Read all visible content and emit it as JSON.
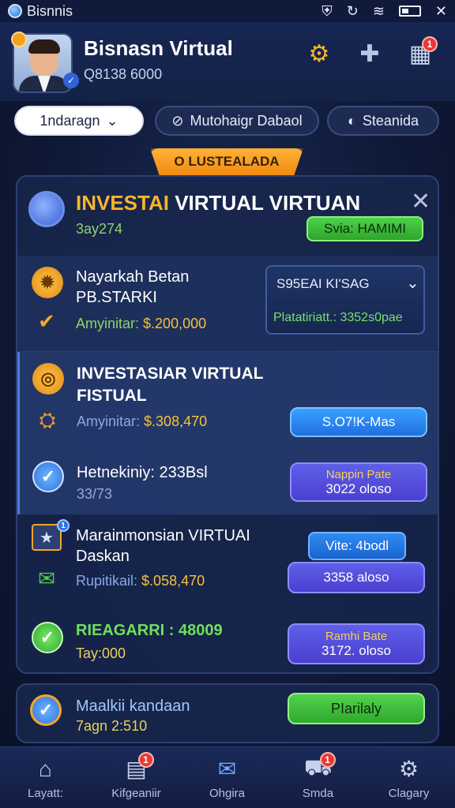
{
  "status_bar": {
    "app_name": "Bisnnis"
  },
  "header": {
    "name": "Bisnasn Virtual",
    "id": "Q8138 6000",
    "box_badge": "1"
  },
  "filters": {
    "dropdown_label": "1ndaragn",
    "pill2_label": "Mutohaigr Dabaol",
    "pill3_label": "Steanida"
  },
  "ribbon": {
    "label": "O LUSTEALADA"
  },
  "card": {
    "title_gold": "INVESTAI",
    "title_white": "VIRTUAL VIRTUAN",
    "subtitle": "3ay274",
    "badge": "Svia: HAMIMI",
    "row1": {
      "title_line1": "Nayarkah Betan",
      "title_line2": "PB.STARKI",
      "amount_label": "Amyinitar:",
      "amount_value": "$.200,000",
      "select_top": "S95EAI KI'SAG",
      "select_bottom": "Platatiriatt.: 3352s0pae"
    },
    "row2": {
      "title_line1": "INVESTASIAR VIRTUAL",
      "title_line2": "FISTUAL",
      "amount_label": "Amyinitar:",
      "amount_value": "$.308,470",
      "btn_label": "S.O7!K-Mas",
      "sub_title": "Hetnekiniy: 233Bsl",
      "sub_text": "33/73",
      "btn2_top": "Nappin Pate",
      "btn2_bottom": "3022 oloso"
    },
    "row3": {
      "title_line1": "Marainmonsian VIRTUAI",
      "title_line2": "Daskan",
      "amount_label": "Rupitikail:",
      "amount_value": "$.058,470",
      "tag_label": "Vite: 4bodl",
      "btn_label": "3358 aloso",
      "green_title": "RIEAGARRI : 48009",
      "gold_text": "Tay:000",
      "btn2_top": "Ramhi Bate",
      "btn2_bottom": "3172. oloso"
    }
  },
  "card2": {
    "title": "Maalkii kandaan",
    "sub": "7agn 2:510",
    "btn_label": "PIarilaly"
  },
  "bottom_nav": [
    {
      "label": "Layatt:",
      "icon": "home-icon"
    },
    {
      "label": "Kifgeaniir",
      "icon": "list-icon",
      "badge": "1"
    },
    {
      "label": "Ohgira",
      "icon": "mail-icon"
    },
    {
      "label": "Smda",
      "icon": "truck-icon",
      "badge": "1"
    },
    {
      "label": "Clagary",
      "icon": "gear-icon"
    }
  ],
  "colors": {
    "gold": "#f7b52b",
    "green": "#6fe05a",
    "blue_accent": "#1f6fe0",
    "purple_accent": "#4a3fd0",
    "bg": "#0f1a38"
  }
}
